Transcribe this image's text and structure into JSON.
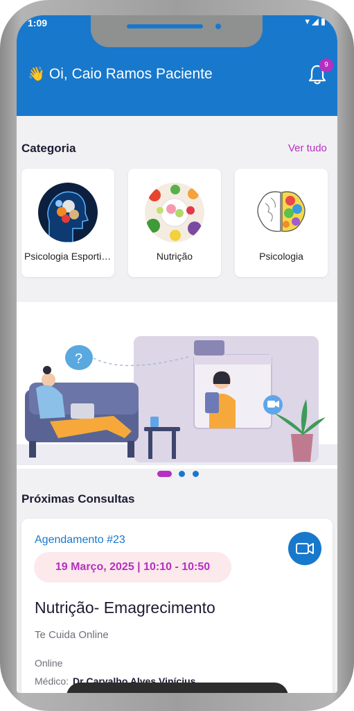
{
  "status": {
    "time": "1:09",
    "icons": "▾◢▮"
  },
  "header": {
    "wave_icon": "👋",
    "greeting": "Oi, Caio Ramos Paciente",
    "notification_count": "9",
    "bg_color": "#1878cc"
  },
  "categories": {
    "title": "Categoria",
    "see_all": "Ver tudo",
    "items": [
      {
        "label": "Psicologia Esportiva"
      },
      {
        "label": "Nutrição"
      },
      {
        "label": "Psicologia"
      }
    ]
  },
  "banner": {
    "dots_total": 3,
    "active_dot": 0
  },
  "appointments": {
    "title": "Próximas Consultas",
    "card": {
      "id_label": "Agendamento #23",
      "date_time": "19 Março, 2025 | 10:10 - 10:50",
      "title": "Nutrição- Emagrecimento",
      "clinic": "Te Cuida Online",
      "mode": "Online",
      "doctor_label": "Médico:",
      "doctor_name": "Dr Carvalho Alves Vinícius"
    }
  },
  "colors": {
    "accent": "#b72ec2",
    "primary": "#1878cc"
  }
}
